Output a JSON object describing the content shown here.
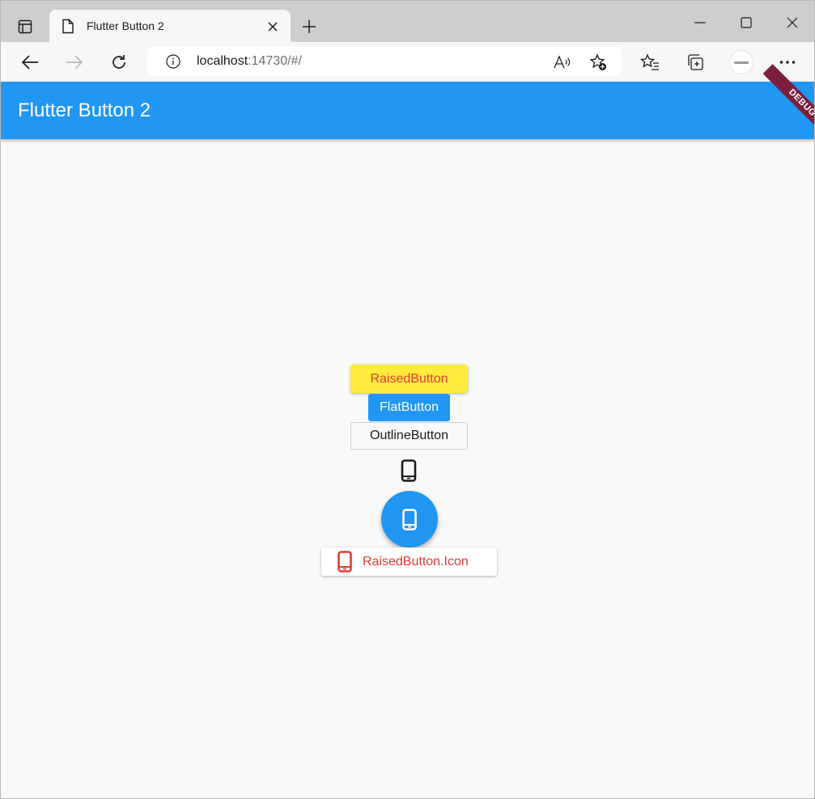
{
  "browser": {
    "tab": {
      "title": "Flutter Button 2"
    },
    "address": {
      "host": "localhost",
      "rest": ":14730/#/"
    },
    "icons": {
      "tab_actions": "tab-actions-icon",
      "page": "document-icon",
      "close": "close-icon",
      "new_tab": "plus-icon",
      "minimize": "minimize-icon",
      "maximize": "maximize-icon",
      "close_window": "close-window-icon",
      "back": "back-arrow-icon",
      "forward": "forward-arrow-icon",
      "refresh": "refresh-icon",
      "site_info": "info-icon",
      "read_aloud": "read-aloud-icon",
      "add_favorite": "add-favorite-icon",
      "favorites": "favorites-icon",
      "collections": "collections-icon",
      "profile": "avatar",
      "more": "more-icon"
    }
  },
  "app": {
    "title": "Flutter Button 2",
    "debug_banner": "DEBUG",
    "primary_color": "#2196f3",
    "buttons": {
      "raised": "RaisedButton",
      "flat": "FlatButton",
      "outline": "OutlineButton",
      "raised_icon": "RaisedButton.Icon"
    },
    "colors": {
      "yellow": "#ffeb3b",
      "red": "#e53935"
    }
  }
}
